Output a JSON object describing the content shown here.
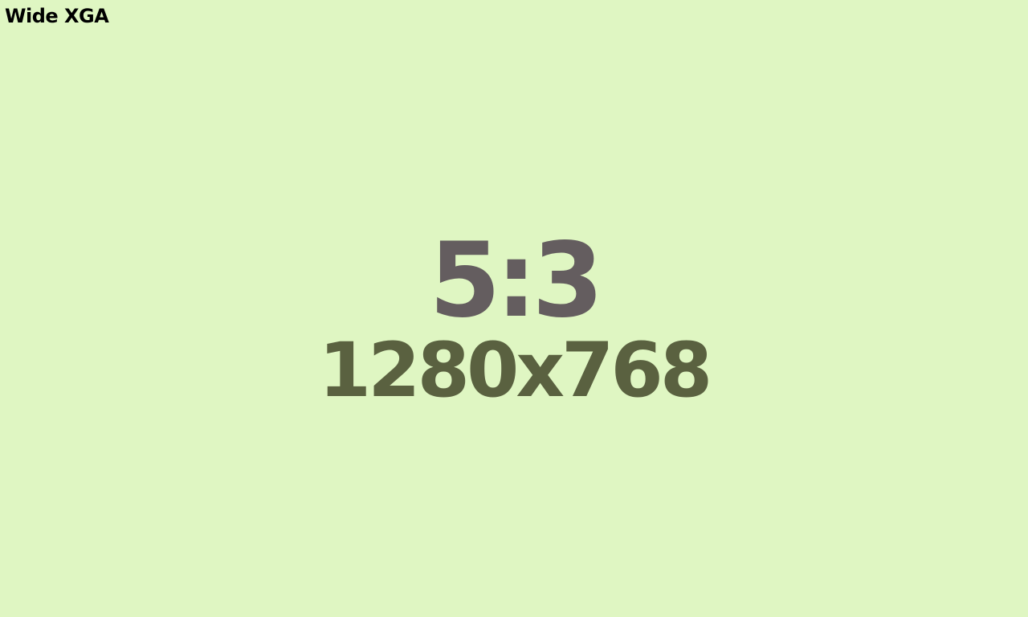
{
  "title": "Wide XGA",
  "aspect_ratio": "5:3",
  "resolution": "1280x768",
  "colors": {
    "background": "#dff6c2",
    "title_text": "#000000",
    "ratio_text": "#645d5f",
    "resolution_text": "#5a6140"
  }
}
